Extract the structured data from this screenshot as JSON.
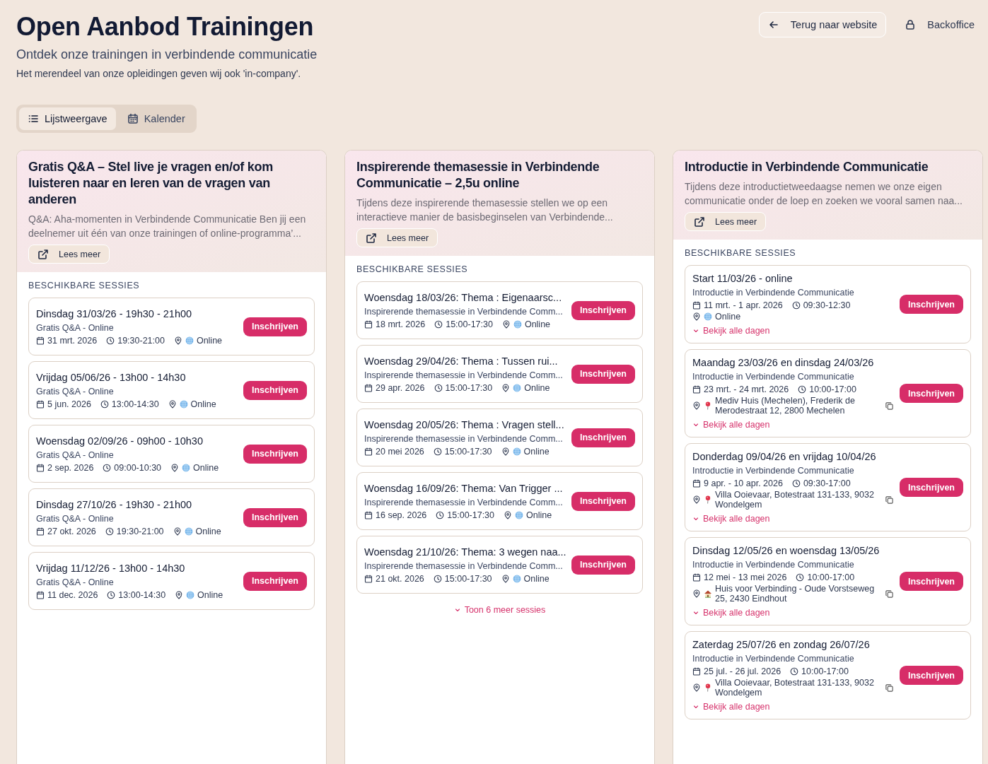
{
  "page": {
    "title": "Open Aanbod Trainingen",
    "subtitle": "Ontdek onze trainingen in verbindende communicatie",
    "note": "Het merendeel van onze opleidingen geven wij ook 'in-company'."
  },
  "top_actions": [
    {
      "kind": "back",
      "label": "Terug naar website"
    },
    {
      "kind": "backoffice",
      "label": "Backoffice"
    }
  ],
  "view_tabs": [
    {
      "kind": "list",
      "label": "Lijstweergave",
      "selected": true
    },
    {
      "kind": "calendar",
      "label": "Kalender",
      "selected": false
    }
  ],
  "trainings": [
    {
      "kind": "single",
      "title": "Gratis Q&A – Stel live je vragen en/of kom luisteren naar en leren van de vragen van anderen",
      "description": "Q&A: Aha-momenten in Verbindende Communicatie Ben jij een deelnemer uit één van onze trainingen of online-programma’...",
      "read_more": "Lees meer",
      "sessions_heading": "BESCHIKBARE SESSIES",
      "sessions": [
        {
          "title": "Dinsdag 31/03/26 - 19h30 - 21h00",
          "subtitle": "Gratis Q&A - Online",
          "date": "31 mrt. 2026",
          "time": "19:30-21:00",
          "location": {
            "kind": "online",
            "text": "Online"
          },
          "button": "Inschrijven"
        },
        {
          "title": "Vrijdag 05/06/26 - 13h00 - 14h30",
          "subtitle": "Gratis Q&A - Online",
          "date": "5 jun. 2026",
          "time": "13:00-14:30",
          "location": {
            "kind": "online",
            "text": "Online"
          },
          "button": "Inschrijven"
        },
        {
          "title": "Woensdag 02/09/26 - 09h00 - 10h30",
          "subtitle": "Gratis Q&A - Online",
          "date": "2 sep. 2026",
          "time": "09:00-10:30",
          "location": {
            "kind": "online",
            "text": "Online"
          },
          "button": "Inschrijven"
        },
        {
          "title": "Dinsdag 27/10/26 - 19h30 - 21h00",
          "subtitle": "Gratis Q&A - Online",
          "date": "27 okt. 2026",
          "time": "19:30-21:00",
          "location": {
            "kind": "online",
            "text": "Online"
          },
          "button": "Inschrijven"
        },
        {
          "title": "Vrijdag 11/12/26 - 13h00 - 14h30",
          "subtitle": "Gratis Q&A - Online",
          "date": "11 dec. 2026",
          "time": "13:00-14:30",
          "location": {
            "kind": "online",
            "text": "Online"
          },
          "button": "Inschrijven"
        }
      ]
    },
    {
      "kind": "single",
      "title": "Inspirerende themasessie in Verbindende Communicatie – 2,5u online",
      "description": "Tijdens deze inspirerende themasessie stellen we op een interactieve manier de basisbeginselen van Verbindende...",
      "read_more": "Lees meer",
      "sessions_heading": "BESCHIKBARE SESSIES",
      "sessions": [
        {
          "title": "Woensdag 18/03/26: Thema : Eigenaarsc...",
          "subtitle": "Inspirerende themasessie in Verbindende Comm...",
          "date": "18 mrt. 2026",
          "time": "15:00-17:30",
          "location": {
            "kind": "online",
            "text": "Online"
          },
          "button": "Inschrijven"
        },
        {
          "title": "Woensdag 29/04/26: Thema : Tussen rui...",
          "subtitle": "Inspirerende themasessie in Verbindende Comm...",
          "date": "29 apr. 2026",
          "time": "15:00-17:30",
          "location": {
            "kind": "online",
            "text": "Online"
          },
          "button": "Inschrijven"
        },
        {
          "title": "Woensdag 20/05/26: Thema : Vragen stell...",
          "subtitle": "Inspirerende themasessie in Verbindende Comm...",
          "date": "20 mei 2026",
          "time": "15:00-17:30",
          "location": {
            "kind": "online",
            "text": "Online"
          },
          "button": "Inschrijven"
        },
        {
          "title": "Woensdag 16/09/26: Thema: Van Trigger ...",
          "subtitle": "Inspirerende themasessie in Verbindende Comm...",
          "date": "16 sep. 2026",
          "time": "15:00-17:30",
          "location": {
            "kind": "online",
            "text": "Online"
          },
          "button": "Inschrijven"
        },
        {
          "title": "Woensdag 21/10/26: Thema: 3 wegen naa...",
          "subtitle": "Inspirerende themasessie in Verbindende Comm...",
          "date": "21 okt. 2026",
          "time": "15:00-17:30",
          "location": {
            "kind": "online",
            "text": "Online"
          },
          "button": "Inschrijven"
        }
      ],
      "more_link": "Toon 6 meer sessies"
    },
    {
      "kind": "multi-day",
      "title": "Introductie in Verbindende Communicatie",
      "description": "Tijdens deze introductietweedaagse nemen we onze eigen communicatie onder de loep en zoeken we vooral samen naa...",
      "read_more": "Lees meer",
      "sessions_heading": "BESCHIKBARE SESSIES",
      "sessions": [
        {
          "title": "Start 11/03/26 - online",
          "subtitle": "Introductie in Verbindende Communicatie",
          "date": "11 mrt. - 1 apr. 2026",
          "time": "09:30-12:30",
          "location": {
            "kind": "online",
            "text": "Online"
          },
          "button": "Inschrijven",
          "days_link": "Bekijk alle dagen"
        },
        {
          "title": "Maandag 23/03/26 en dinsdag 24/03/26",
          "subtitle": "Introductie in Verbindende Communicatie",
          "date": "23 mrt. - 24 mrt. 2026",
          "time": "10:00-17:00",
          "location": {
            "kind": "venue",
            "text": "Mediv Huis (Mechelen), Frederik de Merodestraat 12, 2800 Mechelen"
          },
          "button": "Inschrijven",
          "days_link": "Bekijk alle dagen"
        },
        {
          "title": "Donderdag 09/04/26 en vrijdag 10/04/26",
          "subtitle": "Introductie in Verbindende Communicatie",
          "date": "9 apr. - 10 apr. 2026",
          "time": "09:30-17:00",
          "location": {
            "kind": "venue",
            "text": "Villa Ooievaar, Botestraat 131-133, 9032 Wondelgem"
          },
          "button": "Inschrijven",
          "days_link": "Bekijk alle dagen"
        },
        {
          "title": "Dinsdag 12/05/26 en woensdag 13/05/26",
          "subtitle": "Introductie in Verbindende Communicatie",
          "date": "12 mei - 13 mei 2026",
          "time": "10:00-17:00",
          "location": {
            "kind": "house",
            "text": "Huis voor Verbinding - Oude Vorstseweg 25, 2430 Eindhout"
          },
          "button": "Inschrijven",
          "days_link": "Bekijk alle dagen"
        },
        {
          "title": "Zaterdag 25/07/26 en zondag 26/07/26",
          "subtitle": "Introductie in Verbindende Communicatie",
          "date": "25 jul. - 26 jul. 2026",
          "time": "10:00-17:00",
          "location": {
            "kind": "venue",
            "text": "Villa Ooievaar, Botestraat 131-133, 9032 Wondelgem"
          },
          "button": "Inschrijven",
          "days_link": "Bekijk alle dagen"
        }
      ]
    }
  ]
}
